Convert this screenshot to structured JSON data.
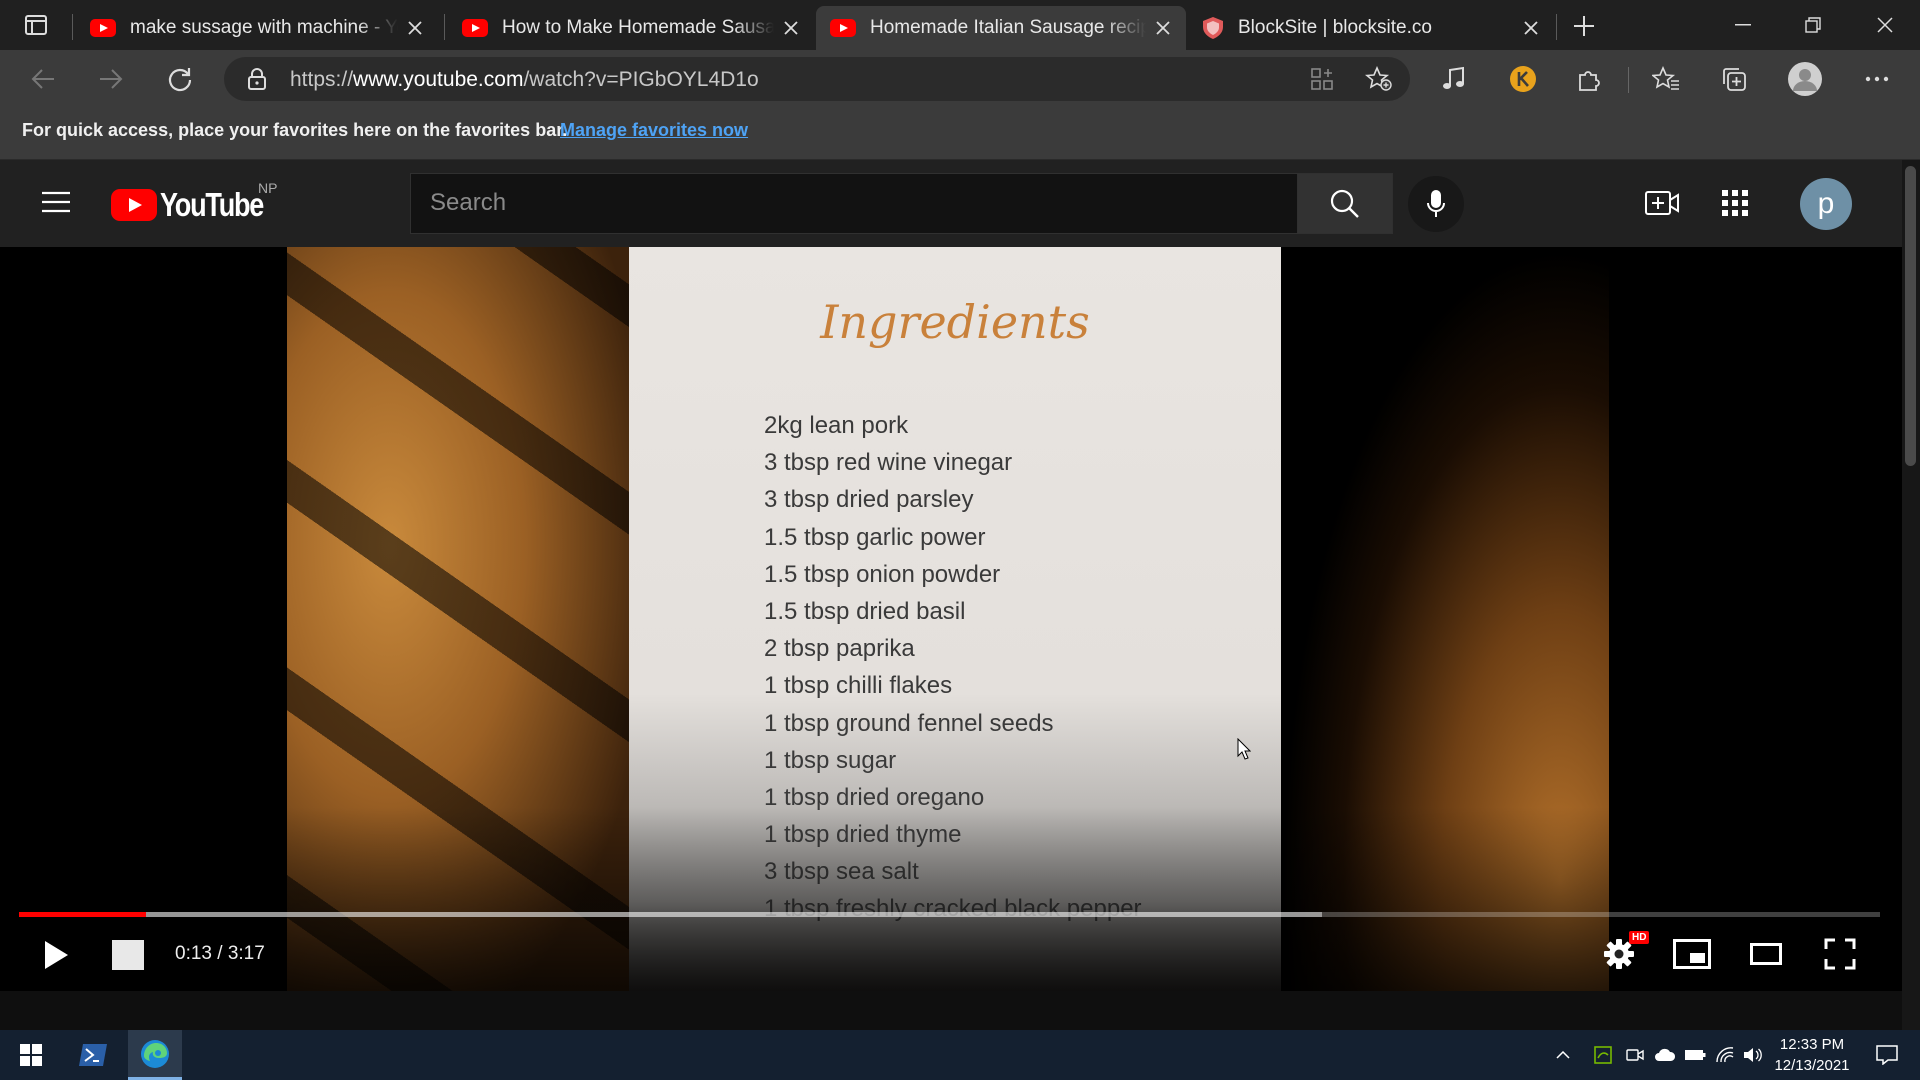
{
  "browser": {
    "tabs": [
      {
        "title": "make sussage with machine - YouTube",
        "icon": "youtube-icon",
        "active": false
      },
      {
        "title": "How to Make Homemade Sausage",
        "icon": "youtube-icon",
        "active": false
      },
      {
        "title": "Homemade Italian Sausage recipe",
        "icon": "youtube-icon",
        "active": true
      },
      {
        "title": "BlockSite | blocksite.co",
        "icon": "blocksite-shield-icon",
        "active": false
      }
    ],
    "url_prefix": "https://",
    "url_host": "www.youtube.com",
    "url_path": "/watch?v=PIGbOYL4D1o",
    "favorites_bar": {
      "message": "For quick access, place your favorites here on the favorites bar.",
      "link": "Manage favorites now"
    }
  },
  "youtube": {
    "logo_text": "YouTube",
    "region": "NP",
    "search_placeholder": "Search",
    "avatar_letter": "p"
  },
  "video": {
    "card_title": "Ingredients",
    "ingredients": [
      "2kg lean pork",
      "3 tbsp red wine vinegar",
      "3 tbsp dried parsley",
      "1.5 tbsp garlic power",
      "1.5 tbsp onion powder",
      "1.5 tbsp dried basil",
      "2 tbsp paprika",
      "1 tbsp chilli flakes",
      "1 tbsp ground fennel seeds",
      "1 tbsp sugar",
      "1 tbsp dried oregano",
      "1 tbsp dried thyme",
      "3 tbsp sea salt",
      "1 tbsp freshly cracked black pepper"
    ],
    "time": "0:13 / 3:17",
    "progress_played": 0.068,
    "progress_buffered": 0.7,
    "quality_badge": "HD",
    "accent_color": "#ff0000"
  },
  "taskbar": {
    "time": "12:33 PM",
    "date": "12/13/2021"
  }
}
